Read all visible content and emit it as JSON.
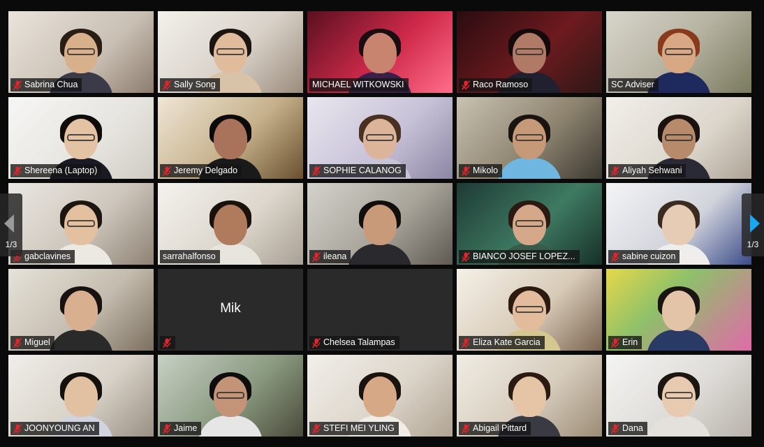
{
  "pagination": {
    "left_label": "1/3",
    "right_label": "1/3"
  },
  "colors": {
    "active_speaker": "#b9d84a",
    "next_arrow": "#19a7f2",
    "muted_mic": "#e0262b"
  },
  "participants": [
    {
      "name": "Sabrina Chua",
      "video": true,
      "muted": true
    },
    {
      "name": "Sally Song",
      "video": true,
      "muted": true
    },
    {
      "name": "MICHAEL WITKOWSKI",
      "video": true,
      "muted": false
    },
    {
      "name": "Raco Ramoso",
      "video": true,
      "muted": true
    },
    {
      "name": "SC Adviser",
      "video": true,
      "muted": false,
      "active_speaker": true
    },
    {
      "name": "Shereena (Laptop)",
      "video": true,
      "muted": true
    },
    {
      "name": "Jeremy Delgado",
      "video": true,
      "muted": true
    },
    {
      "name": "SOPHIE CALANOG",
      "video": true,
      "muted": true
    },
    {
      "name": "Mikolo",
      "video": true,
      "muted": true
    },
    {
      "name": "Aliyah Sehwani",
      "video": true,
      "muted": true
    },
    {
      "name": "gabclavines",
      "video": true,
      "muted": true
    },
    {
      "name": "sarrahalfonso",
      "video": true,
      "muted": false
    },
    {
      "name": "ileana",
      "video": true,
      "muted": true
    },
    {
      "name": "BIANCO JOSEF LOPEZ...",
      "video": true,
      "muted": true
    },
    {
      "name": "sabine cuizon",
      "video": true,
      "muted": true
    },
    {
      "name": "Miguel",
      "video": true,
      "muted": true
    },
    {
      "name": "",
      "video": false,
      "muted": true,
      "display_text": "Mik"
    },
    {
      "name": "Chelsea Talampas",
      "video": false,
      "muted": true
    },
    {
      "name": "Eliza Kate Garcia",
      "video": true,
      "muted": true
    },
    {
      "name": "Erin",
      "video": true,
      "muted": true
    },
    {
      "name": "JOONYOUNG AN",
      "video": true,
      "muted": true
    },
    {
      "name": "Jaime",
      "video": true,
      "muted": true
    },
    {
      "name": "STEFI MEI YLING",
      "video": true,
      "muted": true
    },
    {
      "name": "Abigail Pittard",
      "video": true,
      "muted": true
    },
    {
      "name": "Dana",
      "video": true,
      "muted": true
    }
  ]
}
